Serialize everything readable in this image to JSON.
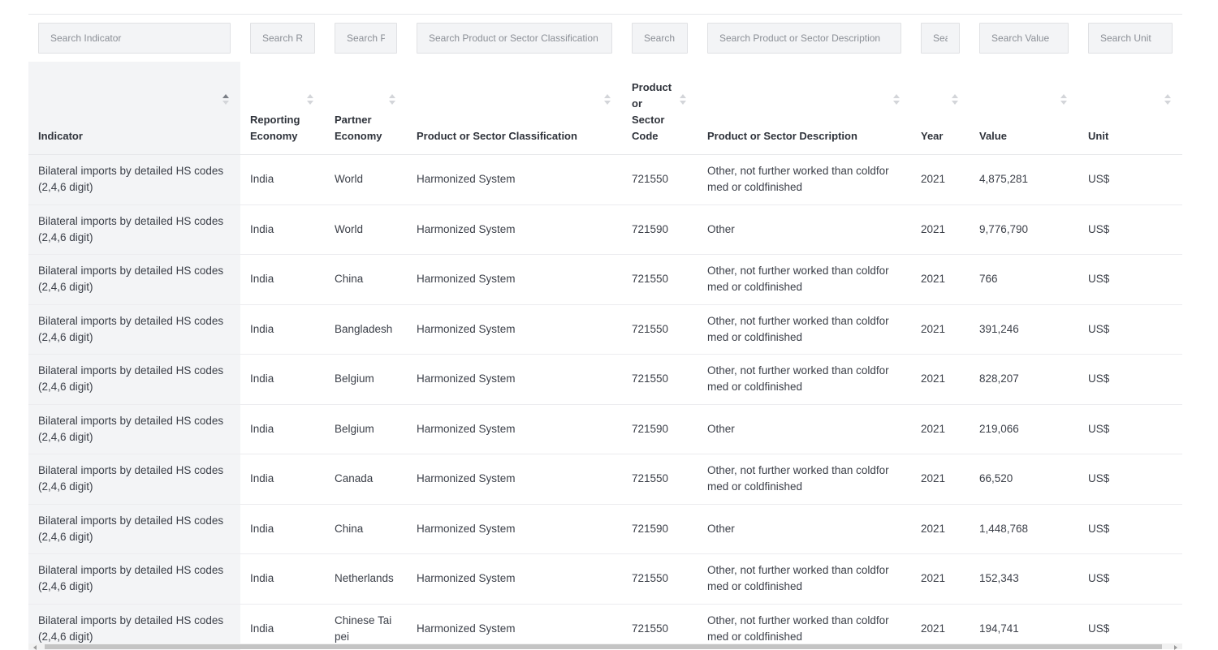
{
  "search": {
    "placeholders": [
      "Search Indicator",
      "Search Reporting Economy",
      "Search Partner Economy",
      "Search Product or Sector Classification",
      "Search Product or Sector Code",
      "Search Product or Sector Description",
      "Search Year",
      "Search Value",
      "Search Unit"
    ]
  },
  "columns": [
    "Indicator",
    "Reporting Economy",
    "Partner Economy",
    "Product or Sector Classification",
    "Product or Sector Code",
    "Product or Sector Description",
    "Year",
    "Value",
    "Unit"
  ],
  "sorted_column": "Indicator",
  "rows": [
    [
      "Bilateral imports by detailed HS codes (2,4,6 digit)",
      "India",
      "World",
      "Harmonized System",
      "721550",
      "Other, not further worked than coldfor med or coldfinished",
      "2021",
      "4,875,281",
      "US$"
    ],
    [
      "Bilateral imports by detailed HS codes (2,4,6 digit)",
      "India",
      "World",
      "Harmonized System",
      "721590",
      "Other",
      "2021",
      "9,776,790",
      "US$"
    ],
    [
      "Bilateral imports by detailed HS codes (2,4,6 digit)",
      "India",
      "China",
      "Harmonized System",
      "721550",
      "Other, not further worked than coldfor med or coldfinished",
      "2021",
      "766",
      "US$"
    ],
    [
      "Bilateral imports by detailed HS codes (2,4,6 digit)",
      "India",
      "Bangladesh",
      "Harmonized System",
      "721550",
      "Other, not further worked than coldfor med or coldfinished",
      "2021",
      "391,246",
      "US$"
    ],
    [
      "Bilateral imports by detailed HS codes (2,4,6 digit)",
      "India",
      "Belgium",
      "Harmonized System",
      "721550",
      "Other, not further worked than coldfor med or coldfinished",
      "2021",
      "828,207",
      "US$"
    ],
    [
      "Bilateral imports by detailed HS codes (2,4,6 digit)",
      "India",
      "Belgium",
      "Harmonized System",
      "721590",
      "Other",
      "2021",
      "219,066",
      "US$"
    ],
    [
      "Bilateral imports by detailed HS codes (2,4,6 digit)",
      "India",
      "Canada",
      "Harmonized System",
      "721550",
      "Other, not further worked than coldfor med or coldfinished",
      "2021",
      "66,520",
      "US$"
    ],
    [
      "Bilateral imports by detailed HS codes (2,4,6 digit)",
      "India",
      "China",
      "Harmonized System",
      "721590",
      "Other",
      "2021",
      "1,448,768",
      "US$"
    ],
    [
      "Bilateral imports by detailed HS codes (2,4,6 digit)",
      "India",
      "Netherlands",
      "Harmonized System",
      "721550",
      "Other, not further worked than coldfor med or coldfinished",
      "2021",
      "152,343",
      "US$"
    ],
    [
      "Bilateral imports by detailed HS codes (2,4,6 digit)",
      "India",
      "Chinese Tai pei",
      "Harmonized System",
      "721550",
      "Other, not further worked than coldfor med or coldfinished",
      "2021",
      "194,741",
      "US$"
    ]
  ]
}
